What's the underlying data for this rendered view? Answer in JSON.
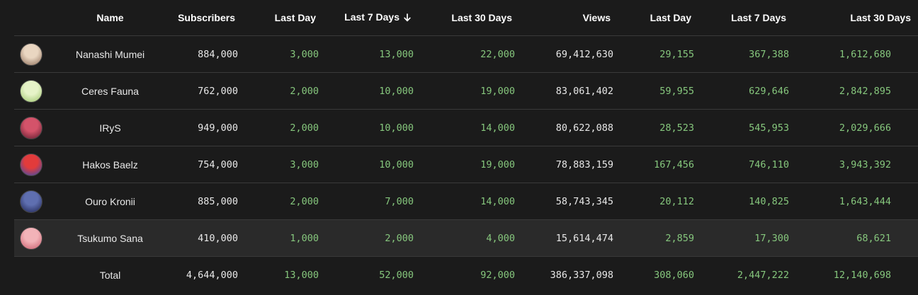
{
  "columns": {
    "name": "Name",
    "subscribers": "Subscribers",
    "subs_last_day": "Last Day",
    "subs_last_7": "Last 7 Days",
    "subs_last_30": "Last 30 Days",
    "views": "Views",
    "views_last_day": "Last Day",
    "views_last_7": "Last 7 Days",
    "views_last_30": "Last 30 Days",
    "sort_icon": "arrow-down-icon"
  },
  "colors": {
    "background": "#1b1b1b",
    "text": "#e8e8e8",
    "positive": "#86c77d",
    "divider": "#3a3a3a",
    "highlight_row": "#2a2a2a"
  },
  "rows": [
    {
      "name": "Nanashi Mumei",
      "subscribers": "884,000",
      "subs_last_day": "3,000",
      "subs_last_7": "13,000",
      "subs_last_30": "22,000",
      "views": "69,412,630",
      "views_last_day": "29,155",
      "views_last_7": "367,388",
      "views_last_30": "1,612,680",
      "avatar_colors": [
        "#e9d6c1",
        "#8a6a55"
      ]
    },
    {
      "name": "Ceres Fauna",
      "subscribers": "762,000",
      "subs_last_day": "2,000",
      "subs_last_7": "10,000",
      "subs_last_30": "19,000",
      "views": "83,061,402",
      "views_last_day": "59,955",
      "views_last_7": "629,646",
      "views_last_30": "2,842,895",
      "avatar_colors": [
        "#e6f3c8",
        "#9cc46a"
      ]
    },
    {
      "name": "IRyS",
      "subscribers": "949,000",
      "subs_last_day": "2,000",
      "subs_last_7": "10,000",
      "subs_last_30": "14,000",
      "views": "80,622,088",
      "views_last_day": "28,523",
      "views_last_7": "545,953",
      "views_last_30": "2,029,666",
      "avatar_colors": [
        "#d4536a",
        "#5a1a2c"
      ]
    },
    {
      "name": "Hakos Baelz",
      "subscribers": "754,000",
      "subs_last_day": "3,000",
      "subs_last_7": "10,000",
      "subs_last_30": "19,000",
      "views": "78,883,159",
      "views_last_day": "167,456",
      "views_last_7": "746,110",
      "views_last_30": "3,943,392",
      "avatar_colors": [
        "#e23b3b",
        "#2a4fb8"
      ]
    },
    {
      "name": "Ouro Kronii",
      "subscribers": "885,000",
      "subs_last_day": "2,000",
      "subs_last_7": "7,000",
      "subs_last_30": "14,000",
      "views": "58,743,345",
      "views_last_day": "20,112",
      "views_last_7": "140,825",
      "views_last_30": "1,643,444",
      "avatar_colors": [
        "#5f6fb0",
        "#1d2250"
      ]
    },
    {
      "name": "Tsukumo Sana",
      "subscribers": "410,000",
      "subs_last_day": "1,000",
      "subs_last_7": "2,000",
      "subs_last_30": "4,000",
      "views": "15,614,474",
      "views_last_day": "2,859",
      "views_last_7": "17,300",
      "views_last_30": "68,621",
      "avatar_colors": [
        "#f2b3b8",
        "#c85a6a"
      ],
      "highlighted": true
    }
  ],
  "total": {
    "label": "Total",
    "subscribers": "4,644,000",
    "subs_last_day": "13,000",
    "subs_last_7": "52,000",
    "subs_last_30": "92,000",
    "views": "386,337,098",
    "views_last_day": "308,060",
    "views_last_7": "2,447,222",
    "views_last_30": "12,140,698"
  }
}
